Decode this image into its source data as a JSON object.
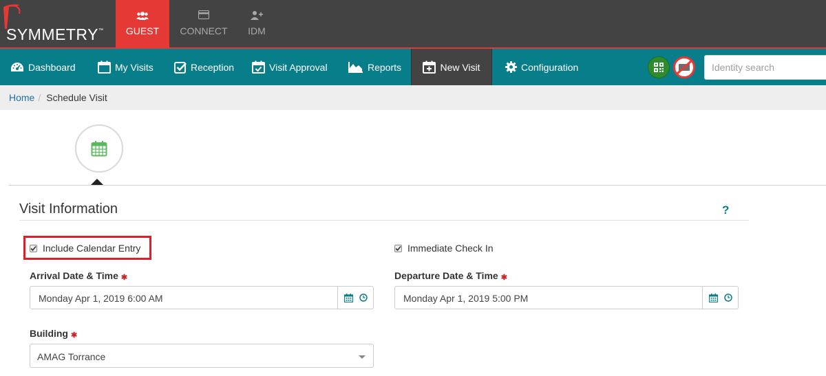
{
  "brand": {
    "name": "SYMMETRY",
    "trademark": "™"
  },
  "top_tabs": [
    {
      "label": "GUEST",
      "icon": "users-icon",
      "active": true
    },
    {
      "label": "CONNECT",
      "icon": "card-icon",
      "active": false
    },
    {
      "label": "IDM",
      "icon": "add-user-icon",
      "active": false
    }
  ],
  "nav": {
    "items": [
      {
        "label": "Dashboard",
        "icon": "dashboard-icon"
      },
      {
        "label": "My Visits",
        "icon": "calendar-icon"
      },
      {
        "label": "Reception",
        "icon": "check-square-icon"
      },
      {
        "label": "Visit Approval",
        "icon": "calendar-check-icon"
      },
      {
        "label": "Reports",
        "icon": "area-chart-icon"
      },
      {
        "label": "New Visit",
        "icon": "calendar-plus-icon",
        "active": true
      },
      {
        "label": "Configuration",
        "icon": "gear-icon"
      }
    ],
    "search_placeholder": "Identity search"
  },
  "breadcrumb": {
    "home": "Home",
    "separator": "/",
    "current": "Schedule Visit"
  },
  "section": {
    "title": "Visit Information",
    "help": "?"
  },
  "form": {
    "include_calendar": {
      "label": "Include Calendar Entry",
      "checked": true
    },
    "immediate_checkin": {
      "label": "Immediate Check In",
      "checked": true
    },
    "arrival": {
      "label": "Arrival Date & Time",
      "required": "✱",
      "value": "Monday Apr 1, 2019 6:00 AM"
    },
    "departure": {
      "label": "Departure Date & Time",
      "required": "✱",
      "value": "Monday Apr 1, 2019 5:00 PM"
    },
    "building": {
      "label": "Building",
      "required": "✱",
      "value": "AMAG Torrance"
    }
  },
  "colors": {
    "topbar": "#434343",
    "accent_red": "#e53935",
    "teal": "#087e8b",
    "highlight": "#e11d2a"
  }
}
